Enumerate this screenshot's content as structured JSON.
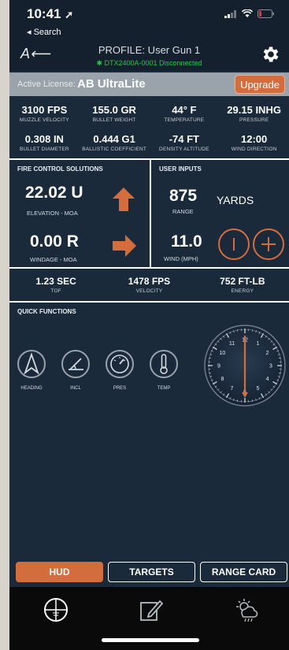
{
  "status_bar": {
    "time": "10:41",
    "back_label": "◂ Search"
  },
  "header": {
    "logo": "A⟵",
    "profile": "PROFILE: User Gun 1",
    "device": "✱ DTX2400A-0001 Disconnected"
  },
  "license": {
    "label": "Active License:",
    "name": "AB UltraLite",
    "upgrade": "Upgrade"
  },
  "stats_row1": [
    {
      "value": "3100 FPS",
      "label": "MUZZLE VELOCITY"
    },
    {
      "value": "155.0 GR",
      "label": "BULLET WEIGHT"
    },
    {
      "value": "44° F",
      "label": "TEMPERATURE"
    },
    {
      "value": "29.15 INHG",
      "label": "PRESSURE"
    }
  ],
  "stats_row2": [
    {
      "value": "0.308 IN",
      "label": "BULLET DIAMETER"
    },
    {
      "value": "0.444 G1",
      "label": "BALLISTIC COEFFICIENT"
    },
    {
      "value": "-74 FT",
      "label": "DENSITY ALTITUDE"
    },
    {
      "value": "12:00",
      "label": "WIND DIRECTION"
    }
  ],
  "fire_control": {
    "title": "FIRE CONTROL SOLUTIONS",
    "elevation_value": "22.02 U",
    "elevation_label": "ELEVATION - MOA",
    "windage_value": "0.00 R",
    "windage_label": "WINDAGE - MOA"
  },
  "user_inputs": {
    "title": "USER INPUTS",
    "range_value": "875",
    "range_unit": "YARDS",
    "range_label": "RANGE",
    "wind_value": "11.0",
    "wind_label": "WIND (MPH)"
  },
  "trajectory": [
    {
      "value": "1.23 SEC",
      "label": "TOF"
    },
    {
      "value": "1478 FPS",
      "label": "VELOCITY"
    },
    {
      "value": "752 FT-LB",
      "label": "ENERGY"
    }
  ],
  "quick_functions": {
    "title": "QUICK FUNCTIONS",
    "items": [
      "HEADING",
      "INCL",
      "PRES",
      "TEMP"
    ]
  },
  "clock": {
    "numbers": [
      "12",
      "1",
      "2",
      "3",
      "4",
      "5",
      "6",
      "7",
      "8",
      "9",
      "10",
      "11"
    ],
    "pointer": "12:00"
  },
  "tabs": [
    {
      "label": "HUD",
      "active": true
    },
    {
      "label": "TARGETS",
      "active": false
    },
    {
      "label": "RANGE CARD",
      "active": false
    }
  ],
  "colors": {
    "accent": "#d36d3e",
    "panel": "#1b2a3b",
    "status_ok": "#2bc34a"
  },
  "icons": [
    "reticle-icon",
    "edit-icon",
    "weather-icon"
  ]
}
